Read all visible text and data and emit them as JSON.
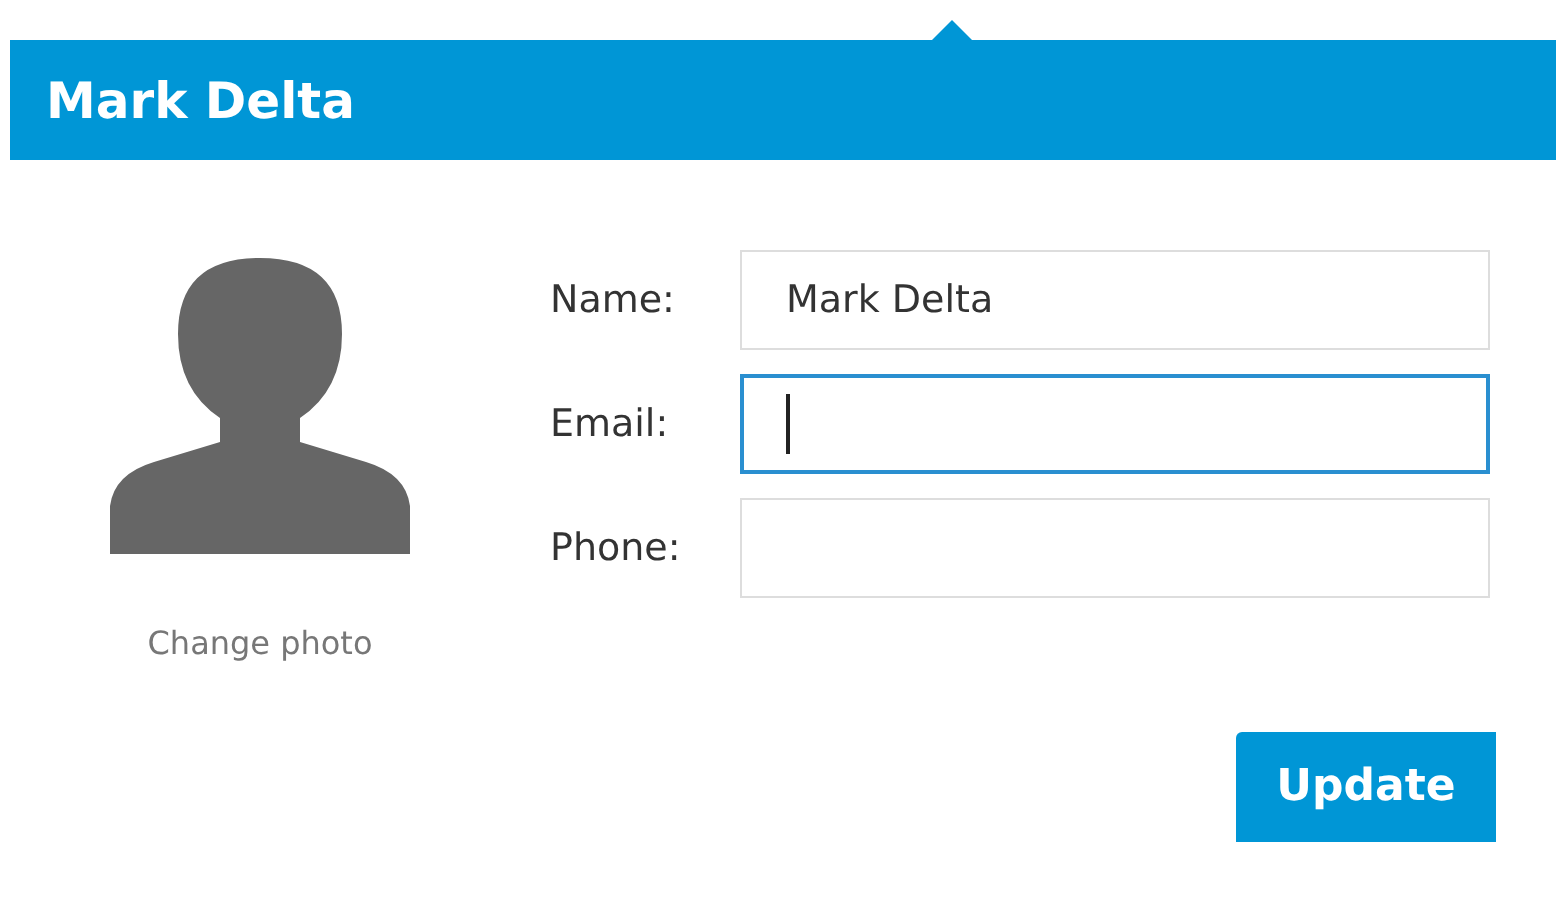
{
  "header": {
    "title": "Mark Delta"
  },
  "photo": {
    "link": "Change photo"
  },
  "fields": [
    {
      "label": "Name:",
      "value": "Mark Delta",
      "focused": false
    },
    {
      "label": "Email:",
      "focused": true
    },
    {
      "label": "Phone:",
      "focused": false
    }
  ],
  "buttons": [
    "Update"
  ]
}
